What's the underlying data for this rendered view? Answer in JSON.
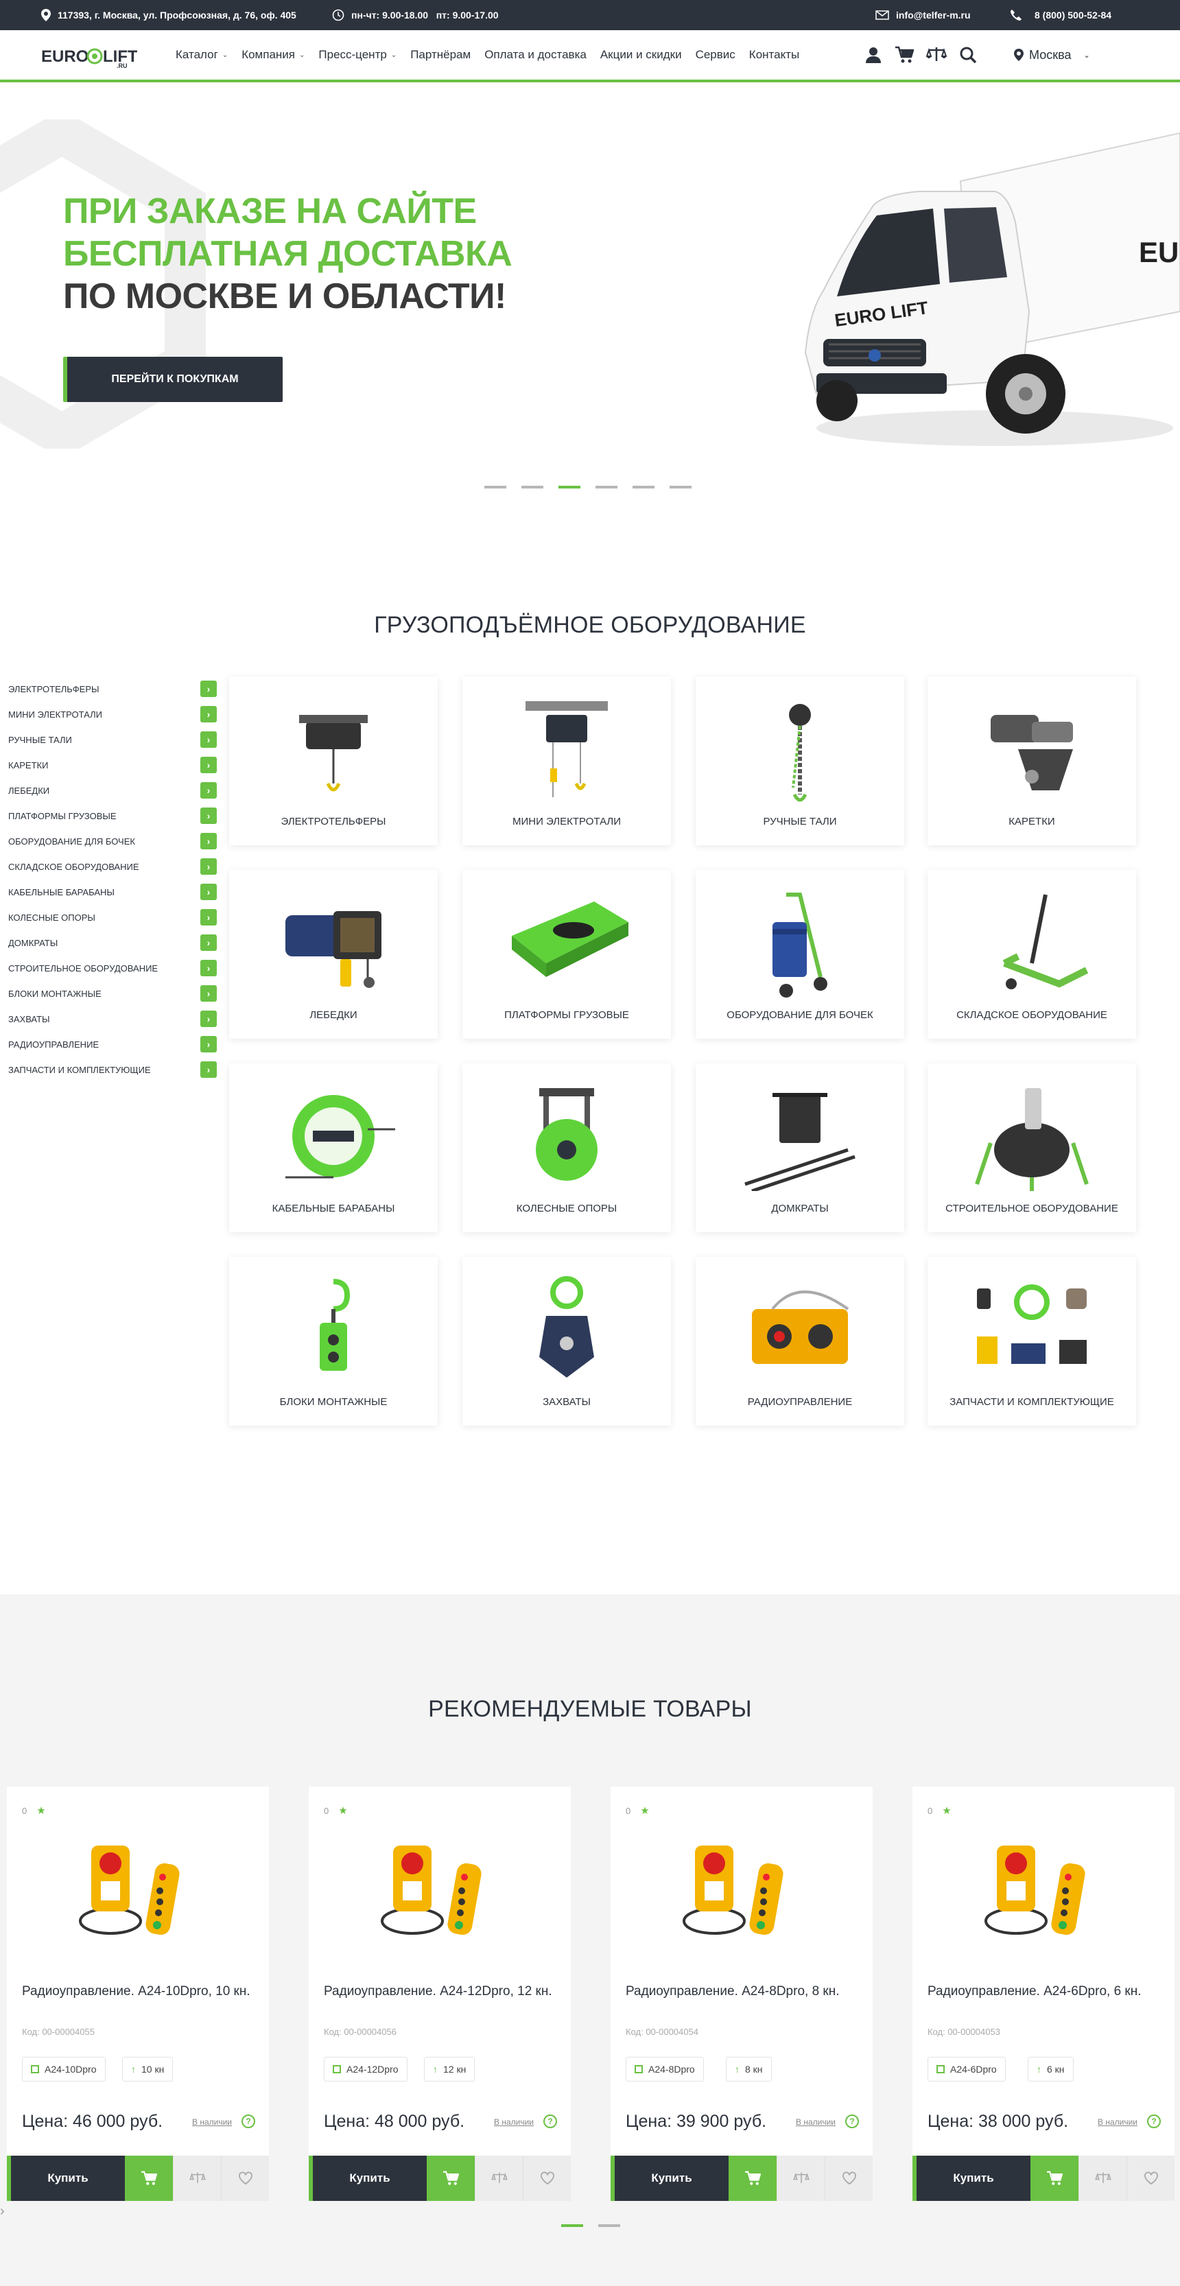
{
  "topbar": {
    "address": "117393, г. Москва, ул. Профсоюзная, д. 76, оф. 405",
    "hours": "пн-чт: 9.00-18.00   пт: 9.00-17.00",
    "email": "info@telfer-m.ru",
    "phone": "8 (800) 500-52-84"
  },
  "header": {
    "logo": "EURO LIFT",
    "logo_suffix": ".RU",
    "nav": [
      "Каталог",
      "Компания",
      "Пресс-центр",
      "Партнёрам",
      "Оплата и доставка",
      "Акции и скидки",
      "Сервис",
      "Контакты"
    ],
    "city": "Москва"
  },
  "hero": {
    "line1": "ПРИ ЗАКАЗЕ НА САЙТЕ",
    "line2": "БЕСПЛАТНАЯ ДОСТАВКА",
    "line3": "ПО МОСКВЕ И ОБЛАСТИ!",
    "button": "ПЕРЕЙТИ К ПОКУПКАМ",
    "truck_text": "EURO LIFT",
    "truck_side": "EUR",
    "slides": 6,
    "active_slide": 3
  },
  "catalog": {
    "title": "ГРУЗОПОДЪЁМНОЕ ОБОРУДОВАНИЕ",
    "sidebar": [
      "ЭЛЕКТРОТЕЛЬФЕРЫ",
      "МИНИ ЭЛЕКТРОТАЛИ",
      "РУЧНЫЕ ТАЛИ",
      "КАРЕТКИ",
      "ЛЕБЕДКИ",
      "ПЛАТФОРМЫ ГРУЗОВЫЕ",
      "ОБОРУДОВАНИЕ ДЛЯ БОЧЕК",
      "СКЛАДСКОЕ ОБОРУДОВАНИЕ",
      "КАБЕЛЬНЫЕ БАРАБАНЫ",
      "КОЛЕСНЫЕ ОПОРЫ",
      "ДОМКРАТЫ",
      "СТРОИТЕЛЬНОЕ ОБОРУДОВАНИЕ",
      "БЛОКИ МОНТАЖНЫЕ",
      "ЗАХВАТЫ",
      "РАДИОУПРАВЛЕНИЕ",
      "ЗАПЧАСТИ И КОМПЛЕКТУЮЩИЕ"
    ],
    "cards": [
      "ЭЛЕКТРОТЕЛЬФЕРЫ",
      "МИНИ ЭЛЕКТРОТАЛИ",
      "РУЧНЫЕ ТАЛИ",
      "КАРЕТКИ",
      "ЛЕБЕДКИ",
      "ПЛАТФОРМЫ ГРУЗОВЫЕ",
      "ОБОРУДОВАНИЕ ДЛЯ БОЧЕК",
      "СКЛАДСКОЕ ОБОРУДОВАНИЕ",
      "КАБЕЛЬНЫЕ БАРАБАНЫ",
      "КОЛЕСНЫЕ ОПОРЫ",
      "ДОМКРАТЫ",
      "СТРОИТЕЛЬНОЕ ОБОРУДОВАНИЕ",
      "БЛОКИ МОНТАЖНЫЕ",
      "ЗАХВАТЫ",
      "РАДИОУПРАВЛЕНИЕ",
      "ЗАПЧАСТИ И КОМПЛЕКТУЮЩИЕ"
    ]
  },
  "recommended": {
    "title": "РЕКОМЕНДУЕМЫЕ ТОВАРЫ",
    "products": [
      {
        "rating": "0",
        "name": "Радиоуправление. А24-10Dpro, 10 кн.",
        "code": "Код: 00-00004055",
        "model": "А24-10Dpro",
        "buttons": "10 кн",
        "price": "Цена: 46 000 руб.",
        "availability": "В наличии",
        "buy": "Купить"
      },
      {
        "rating": "0",
        "name": "Радиоуправление. А24-12Dpro, 12 кн.",
        "code": "Код: 00-00004056",
        "model": "А24-12Dpro",
        "buttons": "12 кн",
        "price": "Цена: 48 000 руб.",
        "availability": "В наличии",
        "buy": "Купить"
      },
      {
        "rating": "0",
        "name": "Радиоуправление. А24-8Dpro, 8 кн.",
        "code": "Код: 00-00004054",
        "model": "А24-8Dpro",
        "buttons": "8 кн",
        "price": "Цена: 39 900 руб.",
        "availability": "В наличии",
        "buy": "Купить"
      },
      {
        "rating": "0",
        "name": "Радиоуправление. А24-6Dpro, 6 кн.",
        "code": "Код: 00-00004053",
        "model": "А24-6Dpro",
        "buttons": "6 кн",
        "price": "Цена: 38 000 руб.",
        "availability": "В наличии",
        "buy": "Купить"
      }
    ],
    "pages": 2,
    "active_page": 1
  },
  "colors": {
    "accent": "#6ac143",
    "dark": "#2d333d",
    "hero_green": "#6ac143",
    "hero_dark": "#3a3a3a"
  },
  "icons": [
    "location-icon",
    "clock-icon",
    "mail-icon",
    "phone-icon",
    "user-icon",
    "cart-icon",
    "compare-icon",
    "search-icon",
    "pin-icon",
    "chevron-right-icon",
    "heart-icon",
    "info-icon"
  ]
}
